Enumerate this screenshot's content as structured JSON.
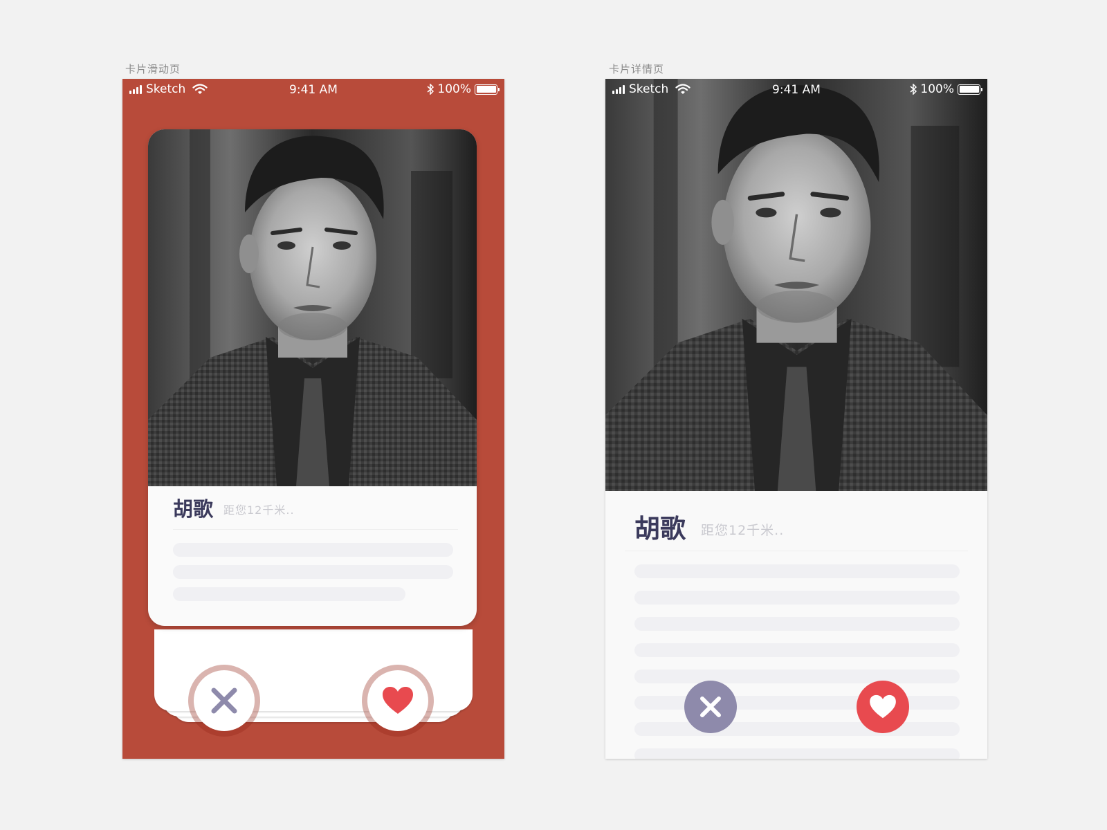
{
  "artboards": [
    {
      "title": "卡片滑动页",
      "status": {
        "carrier": "Sketch",
        "time": "9:41 AM",
        "battery": "100%"
      },
      "profile": {
        "name": "胡歌",
        "distance": "距您12千米.."
      },
      "buttons": {
        "dislike_icon": "close-x-icon",
        "like_icon": "heart-icon"
      }
    },
    {
      "title": "卡片详情页",
      "status": {
        "carrier": "Sketch",
        "time": "9:41 AM",
        "battery": "100%"
      },
      "profile": {
        "name": "胡歌",
        "distance": "距您12千米.."
      },
      "buttons": {
        "dislike_icon": "close-x-icon",
        "like_icon": "heart-icon"
      }
    }
  ],
  "colors": {
    "swipe_background": "#b84b3a",
    "name_text": "#3b3a5c",
    "dislike_purple": "#8e8aab",
    "like_red": "#e84a4f",
    "skeleton": "#f0f0f3"
  }
}
